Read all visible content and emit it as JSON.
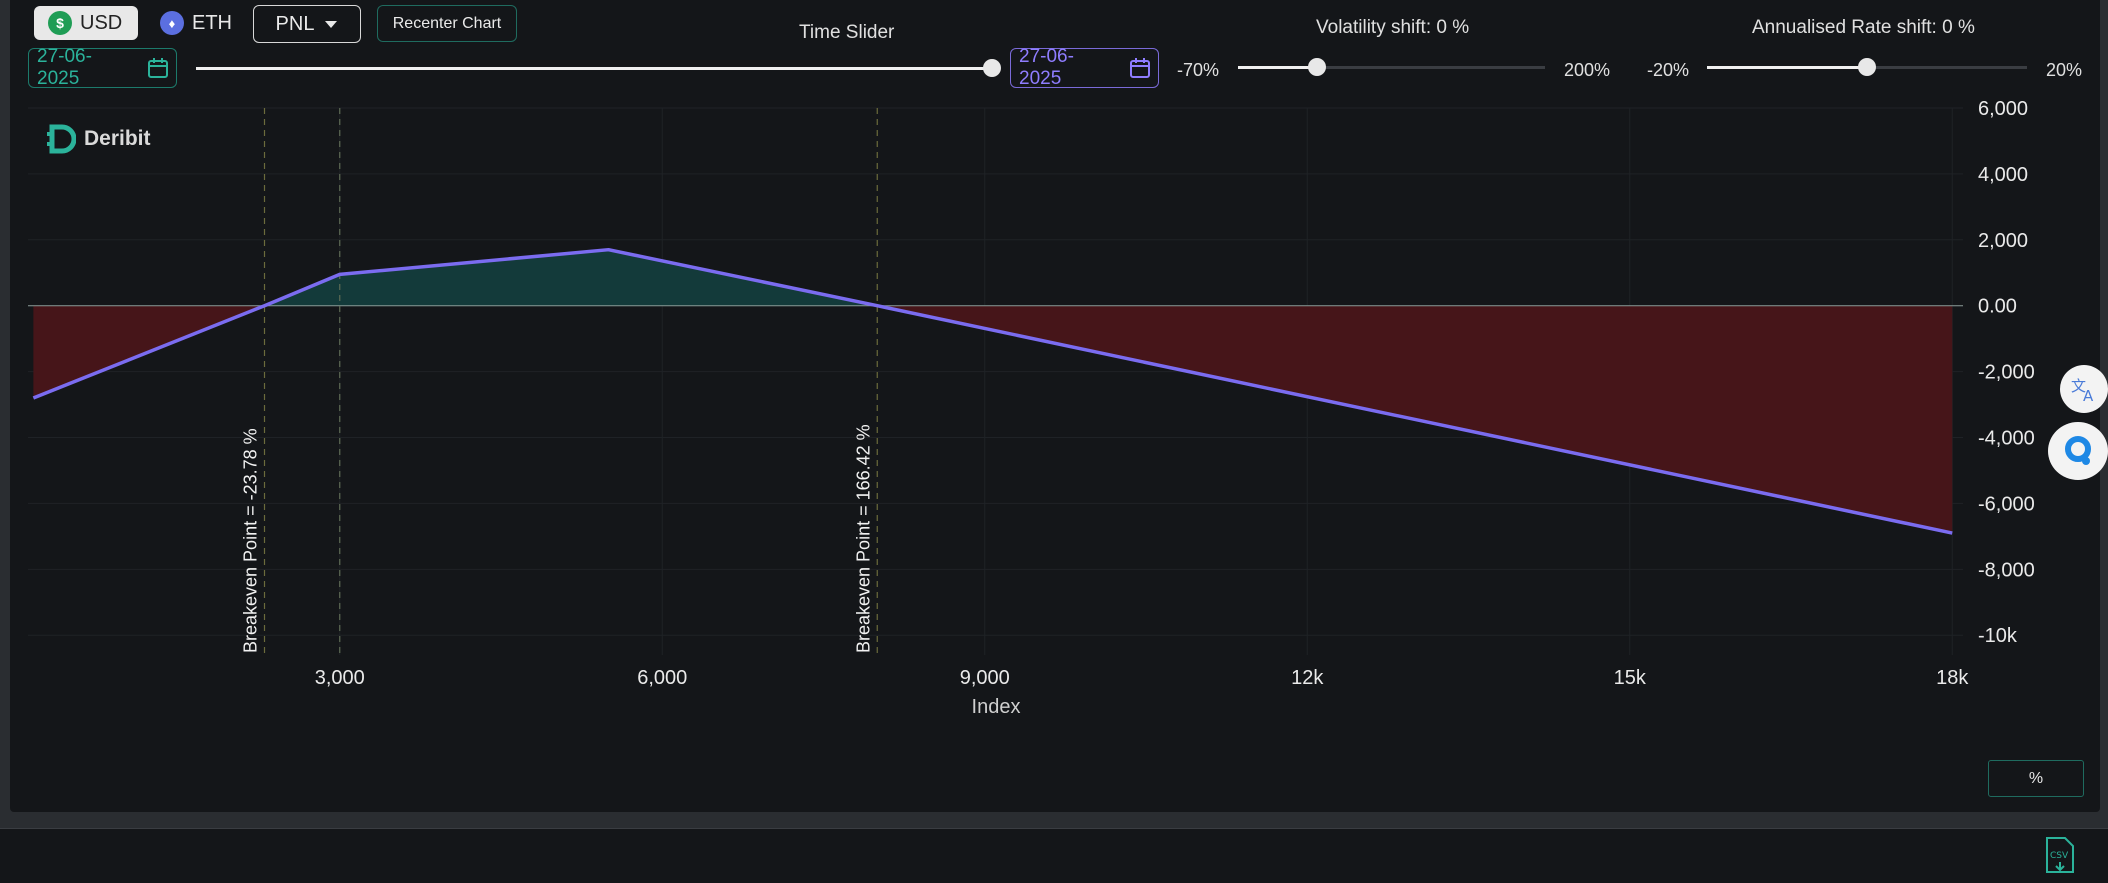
{
  "currency_toggle": {
    "usd_label": "USD",
    "eth_label": "ETH"
  },
  "view_select": {
    "selected": "PNL"
  },
  "recenter_label": "Recenter Chart",
  "time_slider": {
    "title": "Time Slider",
    "start_date": "27-06-2025",
    "end_date": "27-06-2025",
    "value_fraction": 1.0
  },
  "volatility": {
    "title": "Volatility shift: 0 %",
    "min_label": "-70%",
    "max_label": "200%",
    "value_fraction": 0.26
  },
  "rate": {
    "title": "Annualised Rate shift: 0 %",
    "min_label": "-20%",
    "max_label": "20%",
    "value_fraction": 0.5
  },
  "logo": {
    "text": "Deribit"
  },
  "percent_button": "%",
  "colors": {
    "accent_green": "#2bb39b",
    "accent_purple": "#8f7dff",
    "line": "#7b6cf0",
    "profit_fill": "#133a3a",
    "loss_fill": "#461519"
  },
  "chart_data": {
    "type": "area",
    "xlabel": "Index",
    "xlim": [
      100,
      18100
    ],
    "ylim": [
      -10600,
      6000
    ],
    "x_ticks": [
      {
        "value": 3000,
        "label": "3,000"
      },
      {
        "value": 6000,
        "label": "6,000"
      },
      {
        "value": 9000,
        "label": "9,000"
      },
      {
        "value": 12000,
        "label": "12k"
      },
      {
        "value": 15000,
        "label": "15k"
      },
      {
        "value": 18000,
        "label": "18k"
      }
    ],
    "y_ticks": [
      {
        "value": 6000,
        "label": "6,000"
      },
      {
        "value": 4000,
        "label": "4,000"
      },
      {
        "value": 2000,
        "label": "2,000"
      },
      {
        "value": 0,
        "label": "0.00"
      },
      {
        "value": -2000,
        "label": "-2,000"
      },
      {
        "value": -4000,
        "label": "-4,000"
      },
      {
        "value": -6000,
        "label": "-6,000"
      },
      {
        "value": -8000,
        "label": "-8,000"
      },
      {
        "value": -10000,
        "label": "-10k"
      }
    ],
    "series": [
      {
        "x": [
          150,
          2300,
          3000,
          5500,
          8000,
          18000
        ],
        "y": [
          -2800,
          0,
          950,
          1700,
          0,
          -6900
        ]
      }
    ],
    "breakevens": [
      {
        "x": 2300,
        "label": "Breakeven Point = -23.78 %"
      },
      {
        "x": 8000,
        "label": "Breakeven Point = 166.42 %"
      }
    ],
    "reference_lines": [
      3000
    ]
  }
}
